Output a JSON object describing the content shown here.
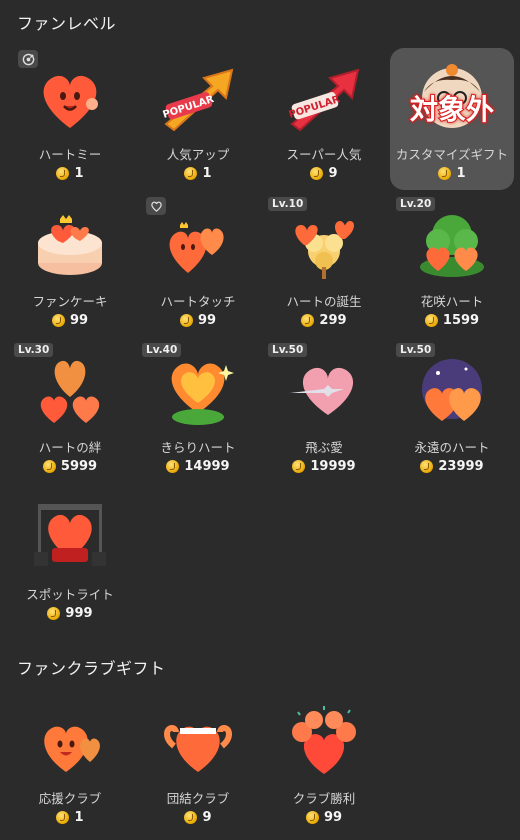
{
  "sections": [
    {
      "title": "ファンレベル",
      "gifts": [
        {
          "name": "ハートミー",
          "price": "1",
          "icon": "heart-me-icon"
        },
        {
          "name": "人気アップ",
          "price": "1",
          "icon": "popular-arrow-icon"
        },
        {
          "name": "スーパー人気",
          "price": "9",
          "icon": "super-popular-icon"
        },
        {
          "name": "カスタマイズギフト",
          "price": "1",
          "icon": "custom-avatar-icon",
          "overlay": "対象外"
        },
        {
          "name": "ファンケーキ",
          "price": "99",
          "icon": "fan-cake-icon"
        },
        {
          "name": "ハートタッチ",
          "price": "99",
          "icon": "heart-touch-icon"
        },
        {
          "name": "ハートの誕生",
          "price": "299",
          "icon": "heart-birth-icon",
          "level": "Lv.10"
        },
        {
          "name": "花咲ハート",
          "price": "1599",
          "icon": "blooming-heart-icon",
          "level": "Lv.20"
        },
        {
          "name": "ハートの絆",
          "price": "5999",
          "icon": "heart-bond-icon",
          "level": "Lv.30"
        },
        {
          "name": "きらりハート",
          "price": "14999",
          "icon": "sparkle-heart-icon",
          "level": "Lv.40"
        },
        {
          "name": "飛ぶ愛",
          "price": "19999",
          "icon": "flying-love-icon",
          "level": "Lv.50"
        },
        {
          "name": "永遠のハート",
          "price": "23999",
          "icon": "eternal-heart-icon",
          "level": "Lv.50"
        },
        {
          "name": "スポットライト",
          "price": "999",
          "icon": "spotlight-icon"
        }
      ]
    },
    {
      "title": "ファンクラブギフト",
      "gifts": [
        {
          "name": "応援クラブ",
          "price": "1",
          "icon": "cheer-club-icon"
        },
        {
          "name": "団結クラブ",
          "price": "9",
          "icon": "unity-club-icon"
        },
        {
          "name": "クラブ勝利",
          "price": "99",
          "icon": "club-victory-icon"
        }
      ]
    }
  ],
  "colors": {
    "background": "#2b2b2b",
    "heart": "#ff6a3d",
    "coin": "#f2b705",
    "overlay_stroke": "#d62020"
  }
}
